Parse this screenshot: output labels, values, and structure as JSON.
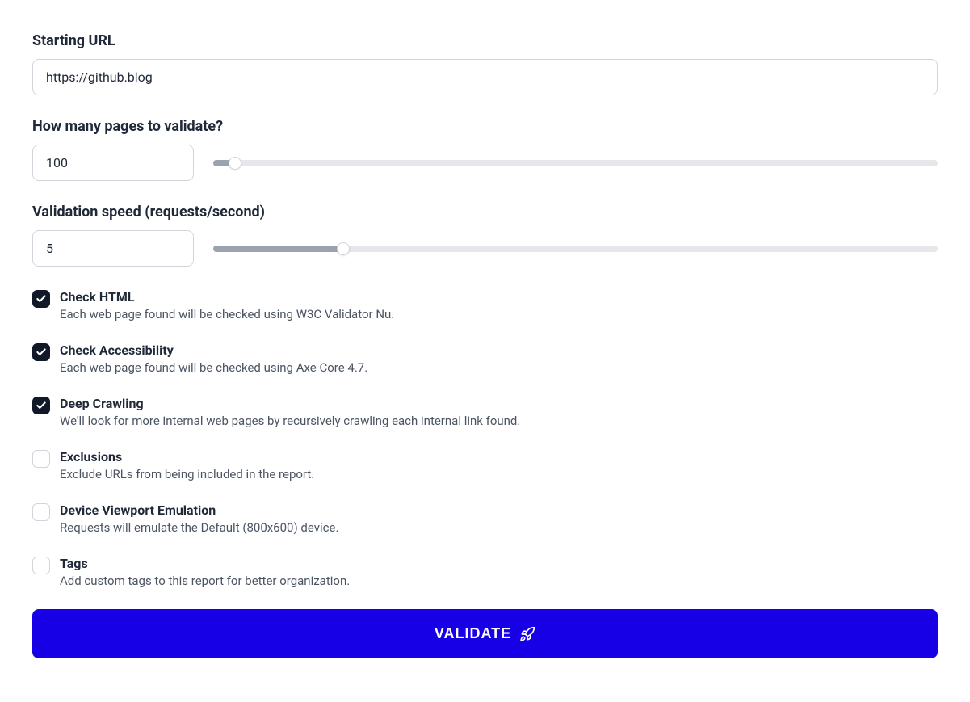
{
  "starting_url": {
    "label": "Starting URL",
    "value": "https://github.blog"
  },
  "pages_to_validate": {
    "label": "How many pages to validate?",
    "value": "100",
    "slider_fill_percent": 3,
    "slider_thumb_percent": 3
  },
  "validation_speed": {
    "label": "Validation speed (requests/second)",
    "value": "5",
    "slider_fill_percent": 18,
    "slider_thumb_percent": 18
  },
  "options": [
    {
      "id": "check-html",
      "title": "Check HTML",
      "description": "Each web page found will be checked using W3C Validator Nu.",
      "checked": true
    },
    {
      "id": "check-accessibility",
      "title": "Check Accessibility",
      "description": "Each web page found will be checked using Axe Core 4.7.",
      "checked": true
    },
    {
      "id": "deep-crawling",
      "title": "Deep Crawling",
      "description": "We'll look for more internal web pages by recursively crawling each internal link found.",
      "checked": true
    },
    {
      "id": "exclusions",
      "title": "Exclusions",
      "description": "Exclude URLs from being included in the report.",
      "checked": false
    },
    {
      "id": "device-viewport",
      "title": "Device Viewport Emulation",
      "description": "Requests will emulate the Default (800x600) device.",
      "checked": false
    },
    {
      "id": "tags",
      "title": "Tags",
      "description": "Add custom tags to this report for better organization.",
      "checked": false
    }
  ],
  "validate_button": {
    "label": "VALIDATE"
  }
}
